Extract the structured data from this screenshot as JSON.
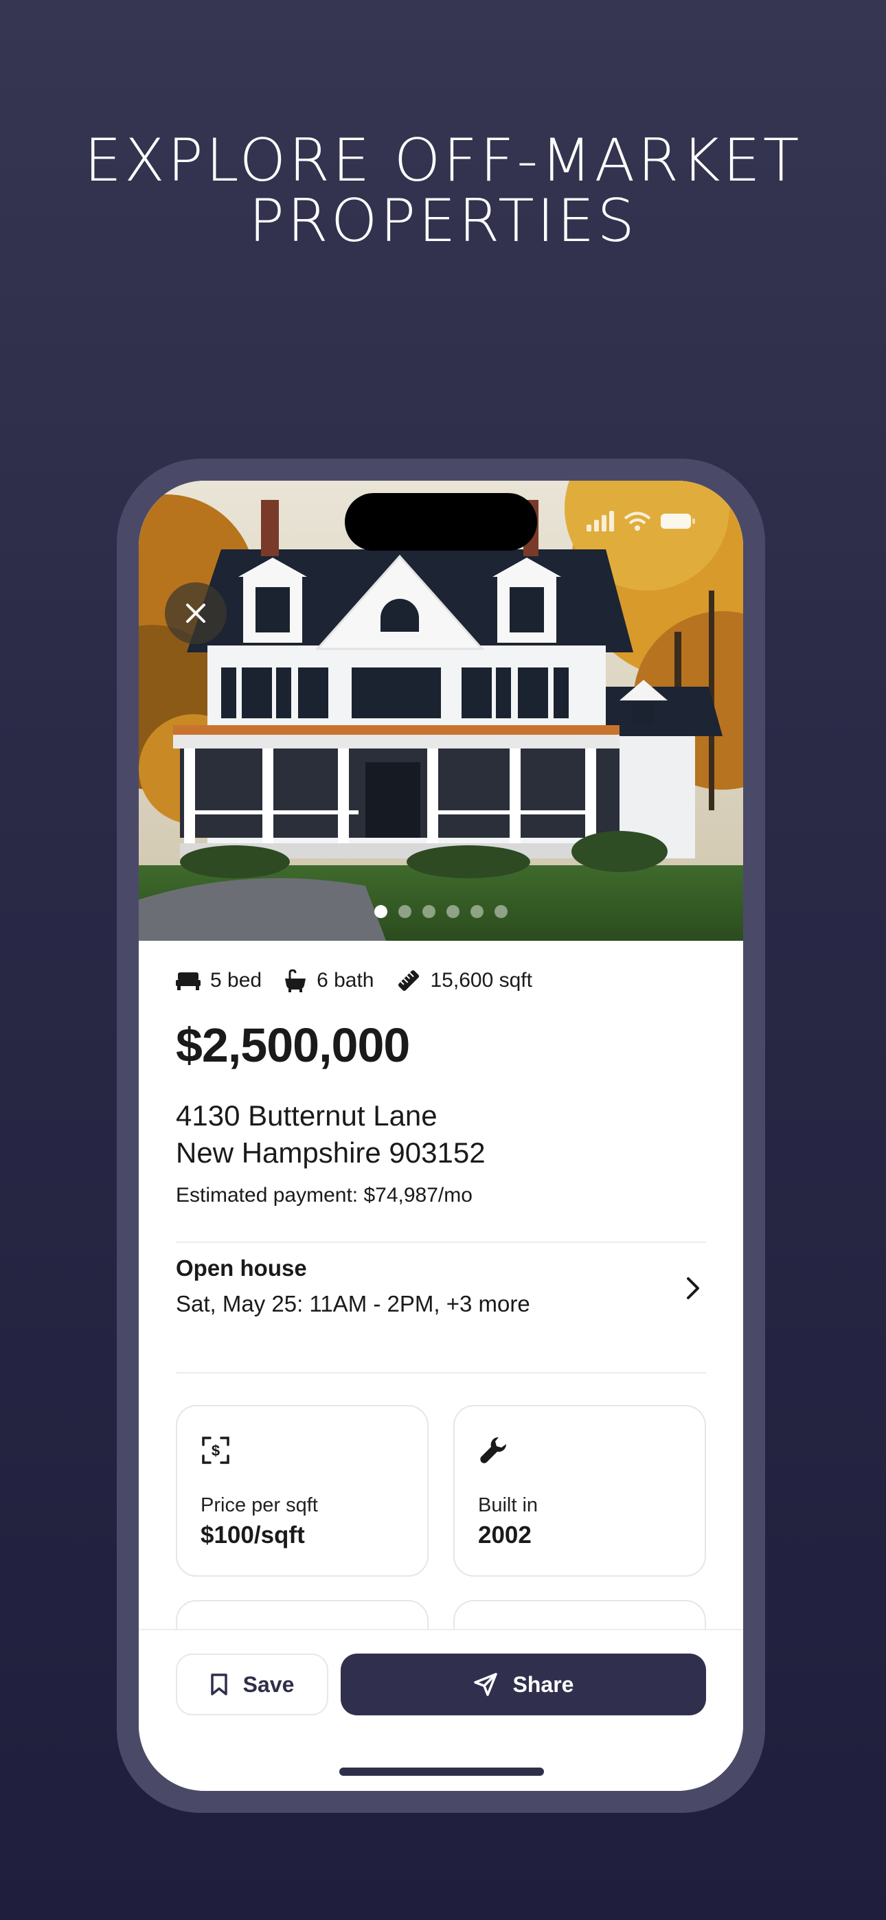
{
  "headline": {
    "line1": "EXPLORE OFF-MARKET",
    "line2": "PROPERTIES"
  },
  "listing": {
    "specs": {
      "beds": "5 bed",
      "baths": "6 bath",
      "area": "15,600 sqft"
    },
    "price": "$2,500,000",
    "address_line1": "4130 Butternut Lane",
    "address_line2": "New Hampshire 903152",
    "estimated_payment": "Estimated payment: $74,987/mo",
    "photo_count": 6,
    "active_photo": 1
  },
  "open_house": {
    "title": "Open house",
    "time": "Sat, May 25: 11AM - 2PM, +3 more"
  },
  "cards": [
    {
      "icon": "dollar-scan-icon",
      "label": "Price per sqft",
      "value": "$100/sqft"
    },
    {
      "icon": "wrench-icon",
      "label": "Built in",
      "value": "2002"
    }
  ],
  "actions": {
    "save_label": "Save",
    "share_label": "Share"
  },
  "colors": {
    "background": "#2a2a47",
    "accent": "#30304e",
    "phone_frame": "#4a4a68"
  }
}
